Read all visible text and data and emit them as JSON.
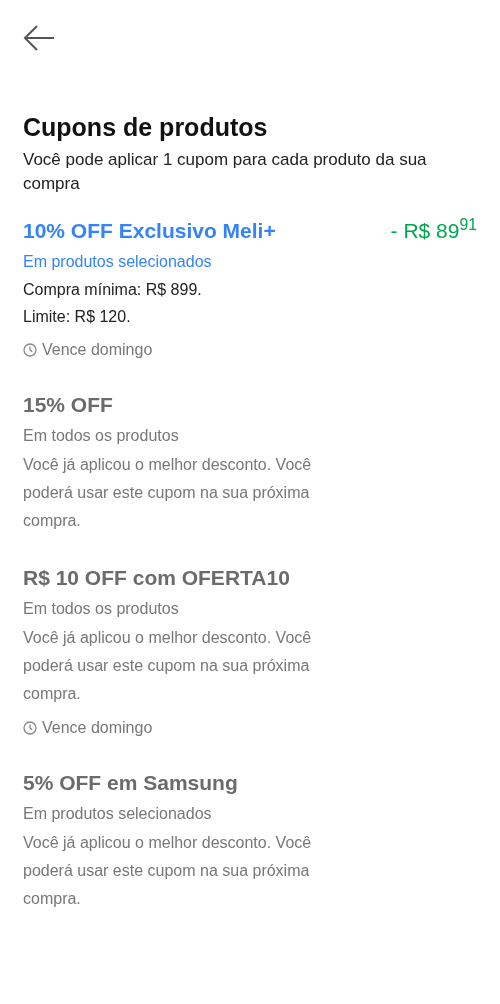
{
  "header": {
    "title": "Cupons de produtos",
    "subtitle": "Você pode aplicar 1 cupom para cada produto da sua compra"
  },
  "coupons": [
    {
      "title": "10% OFF Exclusivo Meli+",
      "applied": true,
      "discount": "- R$ 89$^{91}$",
      "scope": "Em produtos selecionados",
      "details": [
        "Compra mínima: R$ 899.",
        "Limite: R$ 120."
      ],
      "expiry": "Vence domingo"
    },
    {
      "title": "15% OFF",
      "applied": false,
      "scope": "Em todos os produtos",
      "message": "Você já aplicou o melhor desconto. Você poderá usar este cupom na sua próxima compra."
    },
    {
      "title": "R$ 10 OFF com OFERTA10",
      "applied": false,
      "scope": "Em todos os produtos",
      "message": "Você já aplicou o melhor desconto. Você poderá usar este cupom na sua próxima compra.",
      "expiry": "Vence domingo"
    },
    {
      "title": "5% OFF em Samsung",
      "applied": false,
      "scope": "Em produtos selecionados",
      "message": "Você já aplicou o melhor desconto. Você poderá usar este cupom na sua próxima compra."
    }
  ]
}
